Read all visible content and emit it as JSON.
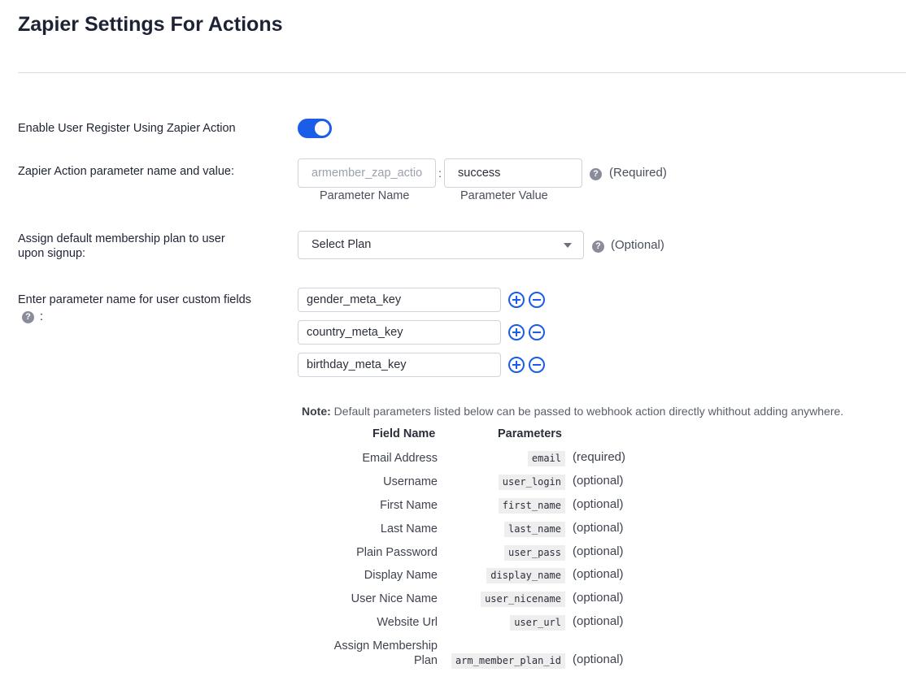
{
  "page_title": "Zapier Settings For Actions",
  "enable_register": {
    "label": "Enable User Register Using Zapier Action",
    "enabled": true
  },
  "param_row": {
    "label": "Zapier Action parameter name and value:",
    "name_placeholder": "armember_zap_action",
    "value": "success",
    "separator": ":",
    "name_caption": "Parameter Name",
    "value_caption": "Parameter Value",
    "hint": "(Required)"
  },
  "plan_row": {
    "label_line1": "Assign default membership plan to user",
    "label_line2": "upon signup:",
    "selected": "Select Plan",
    "hint": "(Optional)"
  },
  "custom_fields": {
    "label": "Enter parameter name for user custom fields",
    "label_suffix": ":",
    "items": [
      "gender_meta_key",
      "country_meta_key",
      "birthday_meta_key"
    ]
  },
  "note": {
    "prefix": "Note:",
    "text": "Default parameters listed below can be passed to webhook action directly whithout adding anywhere."
  },
  "param_table": {
    "headers": [
      "Field Name",
      "Parameters"
    ],
    "rows": [
      {
        "field": "Email Address",
        "param": "email",
        "req": "(required)"
      },
      {
        "field": "Username",
        "param": "user_login",
        "req": "(optional)"
      },
      {
        "field": "First Name",
        "param": "first_name",
        "req": "(optional)"
      },
      {
        "field": "Last Name",
        "param": "last_name",
        "req": "(optional)"
      },
      {
        "field": "Plain Password",
        "param": "user_pass",
        "req": "(optional)"
      },
      {
        "field": "Display Name",
        "param": "display_name",
        "req": "(optional)"
      },
      {
        "field": "User Nice Name",
        "param": "user_nicename",
        "req": "(optional)"
      },
      {
        "field": "Website Url",
        "param": "user_url",
        "req": "(optional)"
      },
      {
        "field_line1": "Assign Membership",
        "field_line2": "Plan",
        "param": "arm_member_plan_id",
        "req": "(optional)"
      }
    ]
  },
  "help_glyph": "?",
  "colors": {
    "accent": "#1a5de8"
  }
}
